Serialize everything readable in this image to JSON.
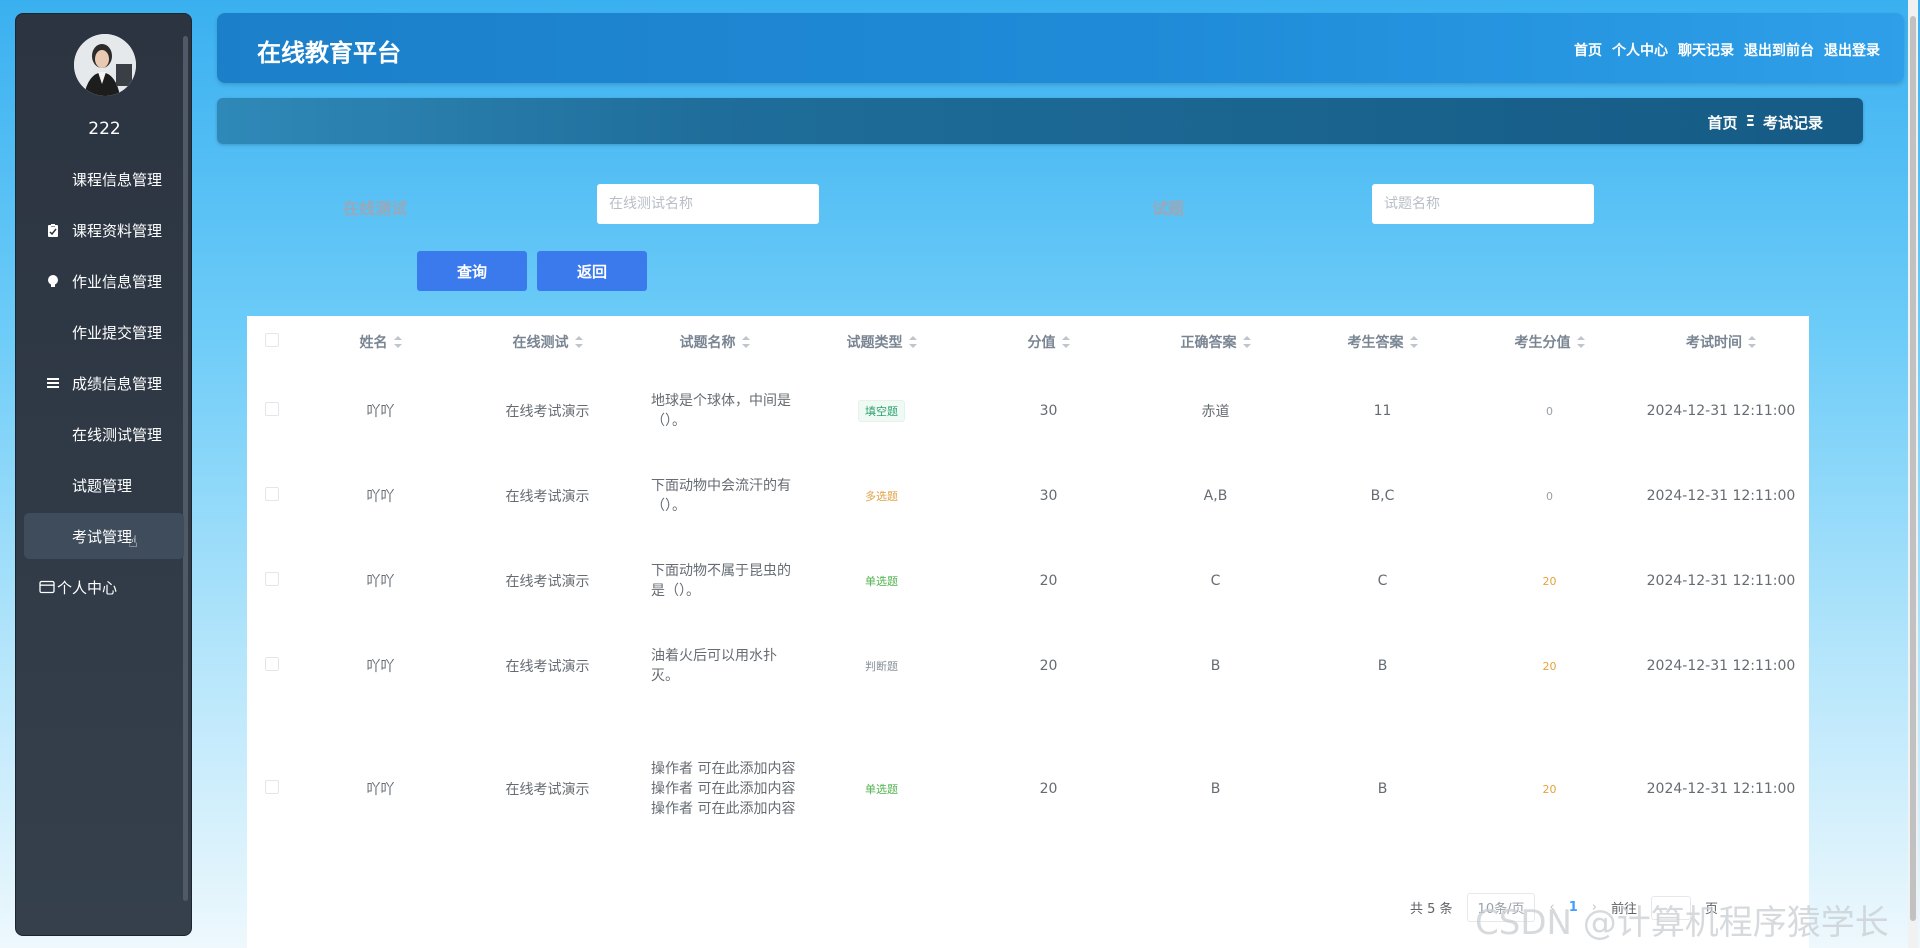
{
  "app": {
    "title": "在线教育平台"
  },
  "header": {
    "nav": [
      "首页",
      "个人中心",
      "聊天记录",
      "退出到前台",
      "退出登录"
    ]
  },
  "user": {
    "name": "222"
  },
  "sidebar": {
    "items": [
      {
        "label": "课程信息管理",
        "icon": "grid-icon"
      },
      {
        "label": "课程资料管理",
        "icon": "clipboard-icon"
      },
      {
        "label": "作业信息管理",
        "icon": "bulb-icon"
      },
      {
        "label": "作业提交管理",
        "icon": "grid-icon"
      },
      {
        "label": "成绩信息管理",
        "icon": "list-icon"
      },
      {
        "label": "在线测试管理",
        "icon": "grid-icon"
      },
      {
        "label": "试题管理",
        "icon": "grid-icon"
      },
      {
        "label": "考试管理",
        "icon": "grid-icon",
        "active": true
      },
      {
        "label": "个人中心",
        "icon": "card-icon"
      }
    ]
  },
  "breadcrumb": {
    "home": "首页",
    "sep": "Ξ",
    "current": "考试记录"
  },
  "search": {
    "test_label": "在线测试",
    "test_placeholder": "在线测试名称",
    "question_label": "试题",
    "question_placeholder": "试题名称",
    "query_label": "查询",
    "back_label": "返回"
  },
  "table": {
    "columns": [
      "姓名",
      "在线测试",
      "试题名称",
      "试题类型",
      "分值",
      "正确答案",
      "考生答案",
      "考生分值",
      "考试时间"
    ],
    "rows": [
      {
        "name": "吖吖",
        "test": "在线考试演示",
        "question": "地球是个球体，中间是（）。",
        "type": "填空题",
        "type_style": "fill",
        "score": "30",
        "answer": "赤道",
        "student_answer": "11",
        "student_score": "0",
        "time": "2024-12-31 12:11:00"
      },
      {
        "name": "吖吖",
        "test": "在线考试演示",
        "question": "下面动物中会流汗的有（）。",
        "type": "多选题",
        "type_style": "multi",
        "score": "30",
        "answer": "A,B",
        "student_answer": "B,C",
        "student_score": "0",
        "time": "2024-12-31 12:11:00"
      },
      {
        "name": "吖吖",
        "test": "在线考试演示",
        "question": "下面动物不属于昆虫的是（）。",
        "type": "单选题",
        "type_style": "single",
        "score": "20",
        "answer": "C",
        "student_answer": "C",
        "student_score": "20",
        "time": "2024-12-31 12:11:00"
      },
      {
        "name": "吖吖",
        "test": "在线考试演示",
        "question": "油着火后可以用水扑灭。",
        "type": "判断题",
        "type_style": "judge",
        "score": "20",
        "answer": "B",
        "student_answer": "B",
        "student_score": "20",
        "time": "2024-12-31 12:11:00"
      },
      {
        "name": "吖吖",
        "test": "在线考试演示",
        "question": "操作者 可在此添加内容 操作者 可在此添加内容 操作者 可在此添加内容",
        "type": "单选题",
        "type_style": "single",
        "score": "20",
        "answer": "B",
        "student_answer": "B",
        "student_score": "20",
        "time": "2024-12-31 12:11:00"
      }
    ]
  },
  "pagination": {
    "total": "共 5 条",
    "page_size": "10条/页",
    "current_page": "1",
    "goto_prefix": "前往",
    "goto_suffix": "页"
  },
  "watermark": "CSDN @计算机程序猿学长",
  "colors": {
    "primary": "#3a7aec",
    "header": "#1f8bd8",
    "sidebar": "#2b3440"
  }
}
